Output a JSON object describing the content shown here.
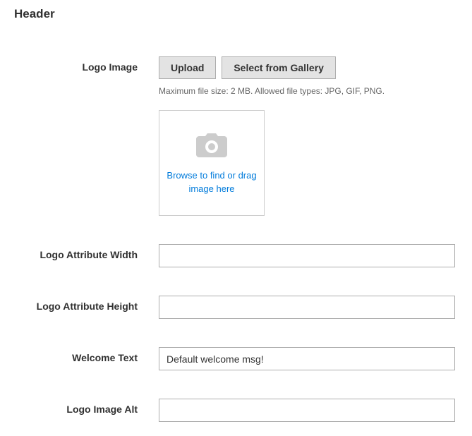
{
  "section": {
    "title": "Header"
  },
  "fields": {
    "logo_image": {
      "label": "Logo Image",
      "upload_button": "Upload",
      "gallery_button": "Select from Gallery",
      "hint": "Maximum file size: 2 MB. Allowed file types: JPG, GIF, PNG.",
      "dropzone_text": "Browse to find or drag image here"
    },
    "logo_width": {
      "label": "Logo Attribute Width",
      "value": ""
    },
    "logo_height": {
      "label": "Logo Attribute Height",
      "value": ""
    },
    "welcome_text": {
      "label": "Welcome Text",
      "value": "Default welcome msg!"
    },
    "logo_alt": {
      "label": "Logo Image Alt",
      "value": ""
    }
  }
}
